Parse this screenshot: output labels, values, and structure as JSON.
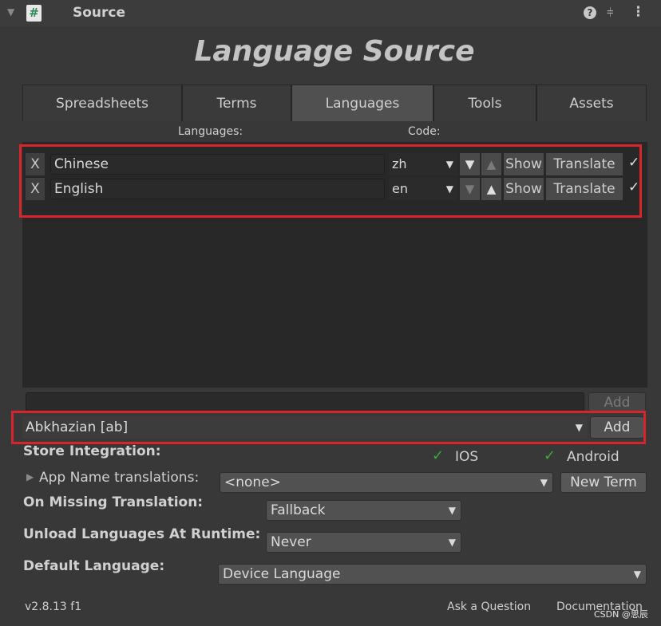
{
  "header": {
    "title": "Source"
  },
  "main_title": "Language Source",
  "tabs": [
    {
      "label": "Spreadsheets"
    },
    {
      "label": "Terms"
    },
    {
      "label": "Languages"
    },
    {
      "label": "Tools"
    },
    {
      "label": "Assets"
    }
  ],
  "columns": {
    "languages": "Languages:",
    "code": "Code:"
  },
  "languages": [
    {
      "remove": "X",
      "name": "Chinese",
      "code": "zh",
      "show": "Show",
      "translate": "Translate",
      "checked": "✓"
    },
    {
      "remove": "X",
      "name": "English",
      "code": "en",
      "show": "Show",
      "translate": "Translate",
      "checked": "✓"
    }
  ],
  "add_custom": {
    "value": "",
    "button": "Add"
  },
  "add_known": {
    "selected": "Abkhazian [ab]",
    "button": "Add"
  },
  "store_integration": {
    "label": "Store Integration:",
    "ios": "IOS",
    "android": "Android"
  },
  "app_name": {
    "label": "App Name translations:",
    "selected": "<none>",
    "button": "New Term"
  },
  "missing_translation": {
    "label": "On Missing Translation:",
    "selected": "Fallback"
  },
  "unload": {
    "label": "Unload Languages At Runtime:",
    "selected": "Never"
  },
  "default_language": {
    "label": "Default Language:",
    "selected": "Device Language"
  },
  "footer": {
    "version": "v2.8.13 f1",
    "ask": "Ask a Question",
    "docs": "Documentation",
    "watermark": "CSDN @思辰"
  },
  "colors": {
    "background": "#383838",
    "highlight": "#d6262c",
    "check": "#3aaa3a"
  }
}
